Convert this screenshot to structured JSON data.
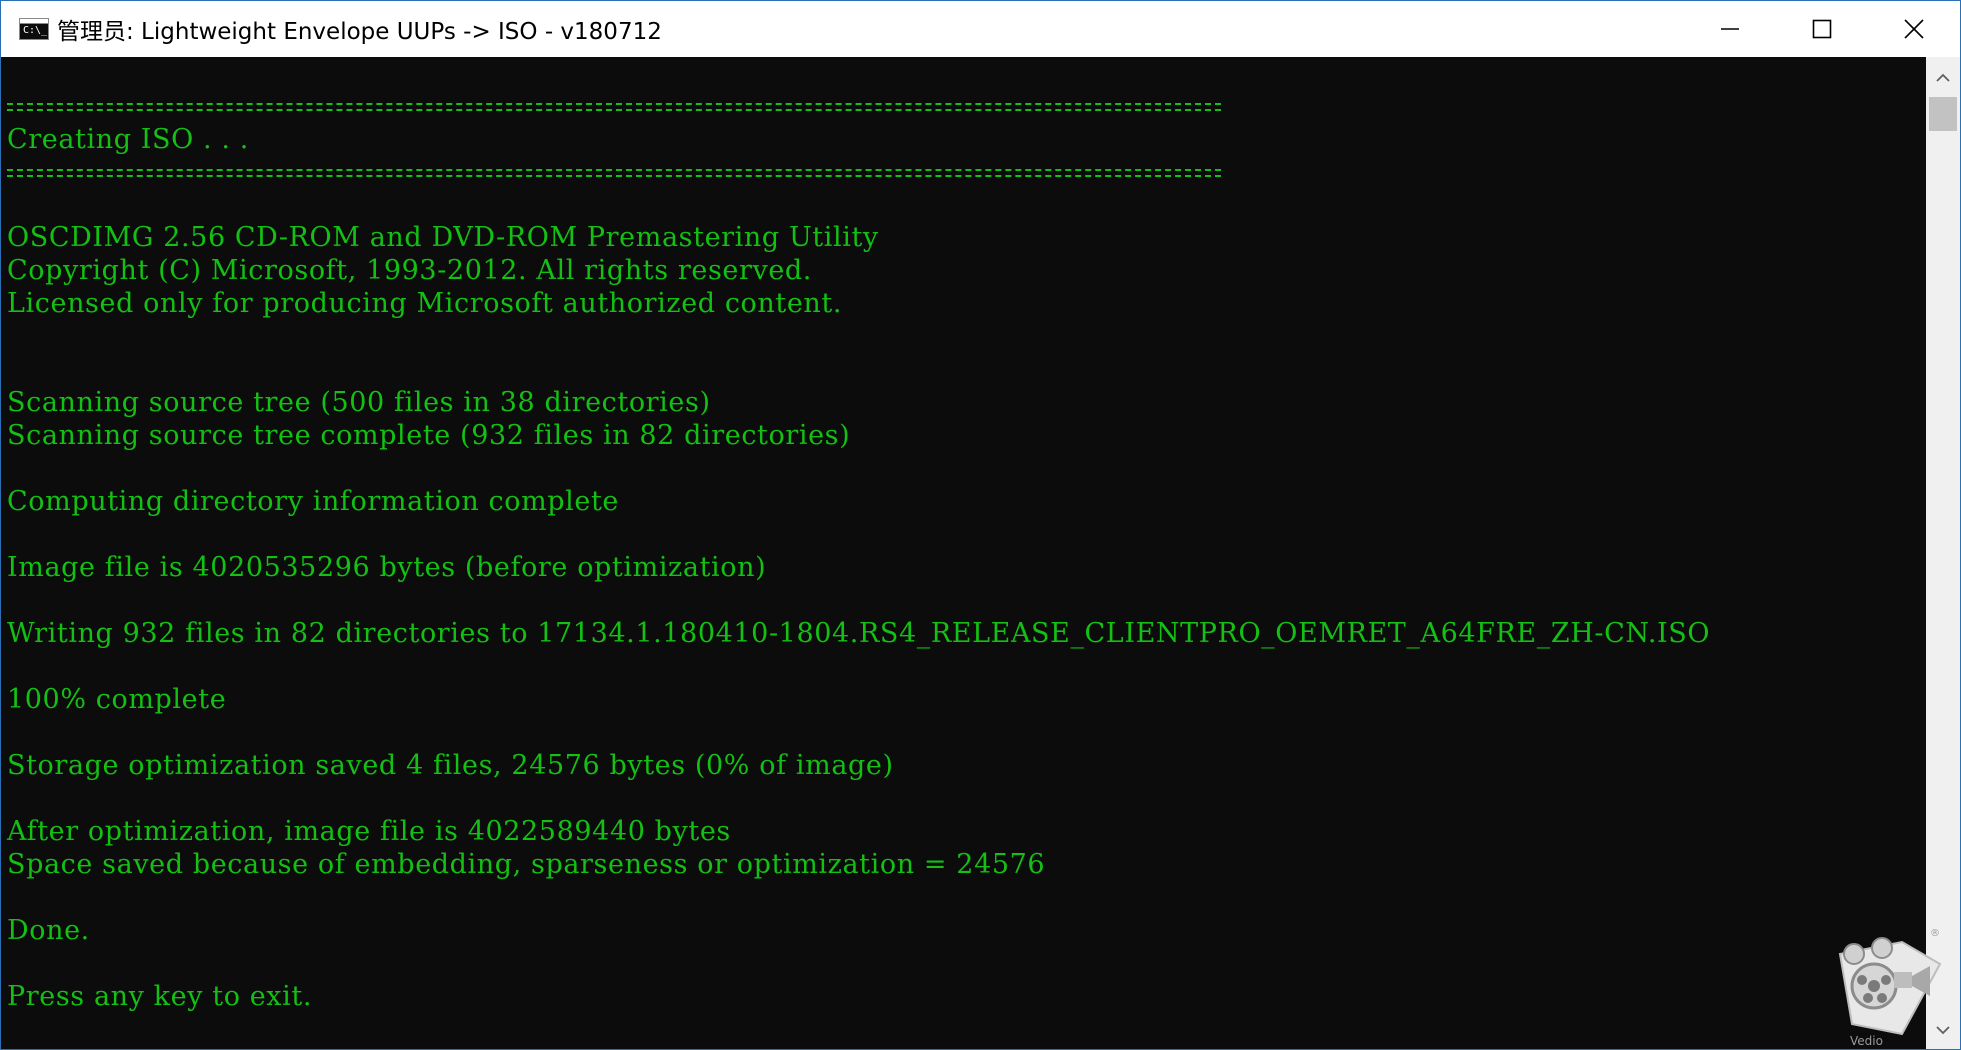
{
  "window": {
    "title": "管理员:  Lightweight Envelope UUPs -> ISO - v180712",
    "icon": "cmd-icon",
    "controls": {
      "minimize": "minimize-icon",
      "maximize": "maximize-icon",
      "close": "close-icon"
    }
  },
  "console": {
    "text_color": "#13c013",
    "background": "#0c0c0c",
    "header": "Creating ISO . . .",
    "lines": [
      "OSCDIMG 2.56 CD-ROM and DVD-ROM Premastering Utility",
      "Copyright (C) Microsoft, 1993-2012. All rights reserved.",
      "Licensed only for producing Microsoft authorized content.",
      "Scanning source tree (500 files in 38 directories)",
      "Scanning source tree complete (932 files in 82 directories)",
      "Computing directory information complete",
      "Image file is 4020535296 bytes (before optimization)",
      "Writing 932 files in 82 directories to 17134.1.180410-1804.RS4_RELEASE_CLIENTPRO_OEMRET_A64FRE_ZH-CN.ISO",
      "100% complete",
      "Storage optimization saved 4 files, 24576 bytes (0% of image)",
      "After optimization, image file is 4022589440 bytes",
      "Space saved because of embedding, sparseness or optimization = 24576",
      "Done.",
      "Press any key to exit."
    ]
  },
  "watermark": {
    "text": "Vedio",
    "icon": "film-camera-logo-icon"
  }
}
